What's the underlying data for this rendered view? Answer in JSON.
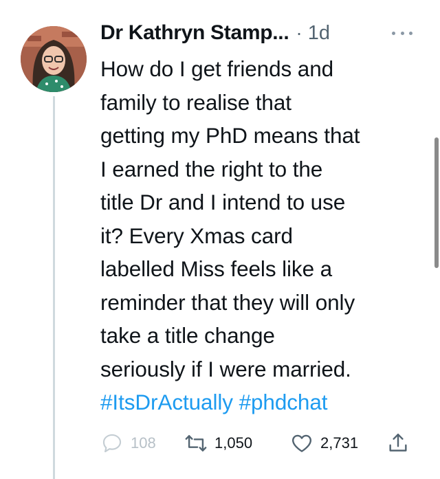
{
  "tweet": {
    "author_name": "Dr Kathryn Stamp...",
    "separator": "·",
    "time": "1d",
    "body_lines": [
      "How do I get friends and",
      "family to realise that",
      "getting my PhD means that",
      "I earned the right to the",
      "title Dr and I intend to use",
      "it? Every Xmas card",
      "labelled Miss feels like a",
      "reminder that they will only",
      "take a title change",
      "seriously if I were married."
    ],
    "hashtags": [
      "#ItsDrActually",
      "#phdchat"
    ]
  },
  "actions": {
    "reply_count": "108",
    "retweet_count": "1,050",
    "like_count": "2,731"
  },
  "icons": {
    "more": "more-dots-icon",
    "reply": "reply-bubble-icon",
    "retweet": "retweet-icon",
    "like": "heart-icon",
    "share": "share-icon"
  },
  "colors": {
    "hashtag": "#1d9bf0",
    "secondary_text": "#536471",
    "thread_line": "#cfd9de"
  }
}
